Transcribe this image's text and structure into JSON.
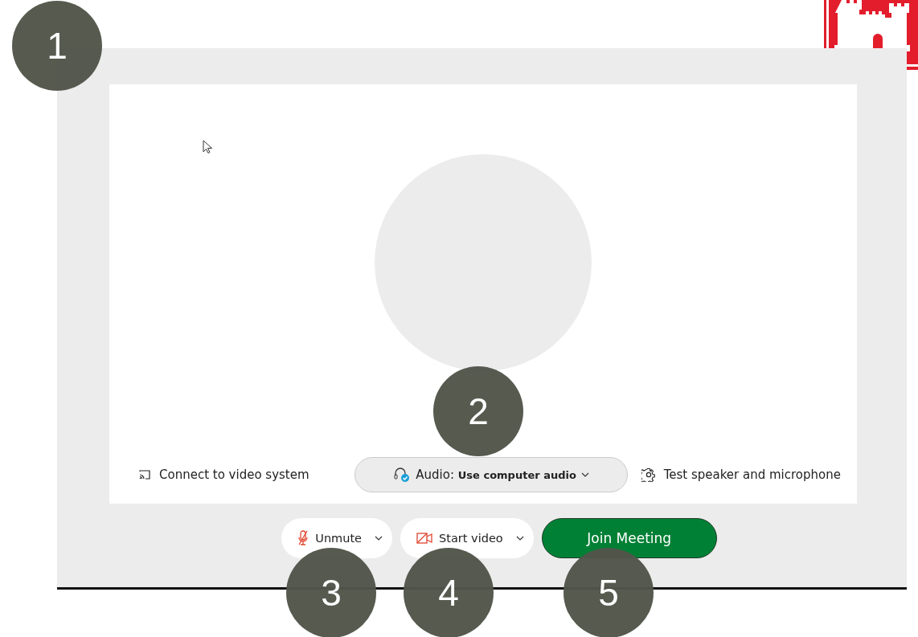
{
  "preview": {
    "connect_label": "Connect to video system",
    "audio_label": "Audio: **Use computer audio**",
    "test_label": "Test speaker and microphone"
  },
  "controls": [
    {
      "kind": "mute",
      "label": "Unmute"
    },
    {
      "kind": "video",
      "label": "Start video"
    },
    {
      "kind": "join",
      "label": "Join Meeting"
    }
  ],
  "callouts": [
    "1",
    "2",
    "3",
    "4",
    "5"
  ]
}
